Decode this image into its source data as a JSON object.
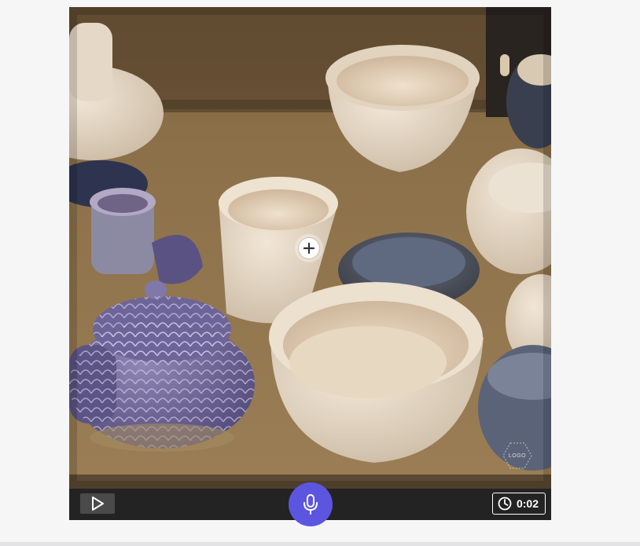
{
  "media": {
    "description_icon": "pottery-photo",
    "add_hotspot_icon": "plus-icon"
  },
  "watermark": {
    "text": "LOGO"
  },
  "controls": {
    "play_icon": "play-icon",
    "mic_icon": "microphone-icon",
    "timer_icon": "clock-icon",
    "timer_value": "0:02"
  },
  "colors": {
    "control_bar": "#232323",
    "mic_accent": "#5b55e0",
    "page_background": "#f6f6f7"
  }
}
